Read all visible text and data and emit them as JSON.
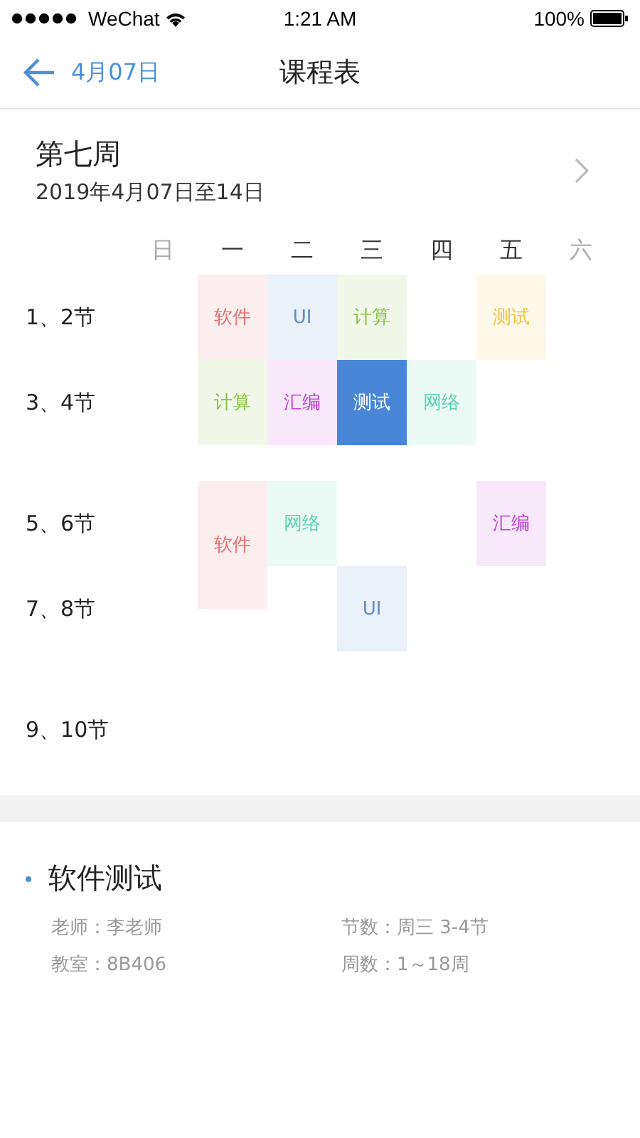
{
  "status_bar": {
    "carrier": "WeChat",
    "time": "1:21 AM",
    "battery": "100%"
  },
  "nav": {
    "back": "4月07日",
    "title": "课程表"
  },
  "week": {
    "title": "第七周",
    "range": "2019年4月07日至14日"
  },
  "days": [
    {
      "label": "日",
      "weekend": true
    },
    {
      "label": "一",
      "weekend": false
    },
    {
      "label": "二",
      "weekend": false
    },
    {
      "label": "三",
      "weekend": false
    },
    {
      "label": "四",
      "weekend": false
    },
    {
      "label": "五",
      "weekend": false
    },
    {
      "label": "六",
      "weekend": true
    }
  ],
  "periods": [
    {
      "label": "1、2节",
      "cells": [
        null,
        {
          "name": "软件",
          "color": "#e57373",
          "selected": false,
          "extended": false
        },
        {
          "name": "UI",
          "color": "#5c8ec9",
          "selected": false,
          "extended": false
        },
        {
          "name": "计算",
          "color": "#8bc34a",
          "selected": false,
          "extended": false
        },
        null,
        {
          "name": "测试",
          "color": "#f5c242",
          "selected": false,
          "extended": false
        },
        null
      ]
    },
    {
      "label": "3、4节",
      "cells": [
        null,
        {
          "name": "计算",
          "color": "#8bc34a",
          "selected": false,
          "extended": false
        },
        {
          "name": "汇编",
          "color": "#c03fd6",
          "selected": false,
          "extended": false
        },
        {
          "name": "测试",
          "color": "#4a86d8",
          "selected": true,
          "extended": false
        },
        {
          "name": "网络",
          "color": "#5fd3b5",
          "selected": false,
          "extended": false
        },
        null,
        null
      ]
    },
    {
      "label": "5、6节",
      "cells": [
        null,
        {
          "name": "软件",
          "color": "#e57373",
          "selected": false,
          "extended": true
        },
        {
          "name": "网络",
          "color": "#5fd3b5",
          "selected": false,
          "extended": false
        },
        null,
        null,
        {
          "name": "汇编",
          "color": "#c03fd6",
          "selected": false,
          "extended": false
        },
        null
      ]
    },
    {
      "label": "7、8节",
      "cells": [
        null,
        null,
        null,
        {
          "name": "UI",
          "color": "#5c8ec9",
          "selected": false,
          "extended": false
        },
        null,
        null,
        null
      ]
    },
    {
      "label": "9、10节",
      "cells": [
        null,
        null,
        null,
        null,
        null,
        null,
        null
      ]
    }
  ],
  "detail": {
    "title": "软件测试",
    "fields": [
      "老师：李老师",
      "节数：周三 3-4节",
      "教室：8B406",
      "周数：1～18周"
    ]
  }
}
